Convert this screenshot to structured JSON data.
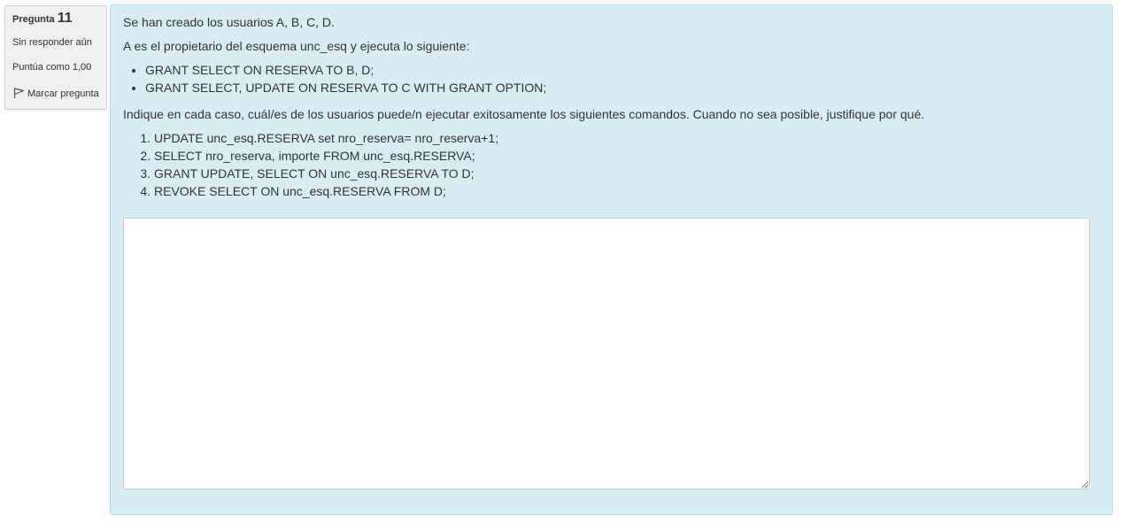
{
  "question_info": {
    "label": "Pregunta",
    "number": "11",
    "state": "Sin responder aún",
    "grade": "Puntúa como 1,00",
    "flag_label": "Marcar pregunta",
    "flag_icon": "flag-icon"
  },
  "question": {
    "intro": "Se han creado los usuarios A, B, C, D.",
    "owner_text": "A es el propietario del esquema unc_esq  y ejecuta lo siguiente:",
    "grants": [
      "GRANT SELECT ON RESERVA TO B, D;",
      "GRANT SELECT, UPDATE ON  RESERVA TO C  WITH GRANT OPTION;"
    ],
    "instruction": "Indique en cada caso, cuál/es de los usuarios puede/n ejecutar exitosamente los siguientes comandos. Cuando no sea posible, justifique por qué.",
    "commands": [
      "UPDATE  unc_esq.RESERVA set nro_reserva= nro_reserva+1;",
      "SELECT nro_reserva, importe FROM unc_esq.RESERVA;",
      "GRANT UPDATE, SELECT ON unc_esq.RESERVA TO D;",
      "REVOKE SELECT ON unc_esq.RESERVA FROM D;"
    ]
  },
  "answer": {
    "value": ""
  },
  "colors": {
    "content_background": "#d8ecf4",
    "info_background": "#f0f0f0"
  }
}
